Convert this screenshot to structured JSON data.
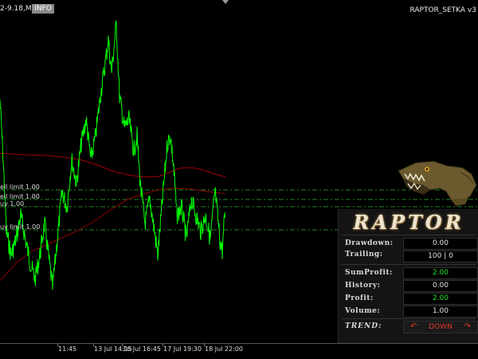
{
  "header": {
    "symbol_timeframe": "2-9.18,M15",
    "info_button": "INFO",
    "indicator_title": "RAPTOR_SETKA v3"
  },
  "chart": {
    "order_labels": [
      {
        "label": "ell limit 1.00"
      },
      {
        "label": "ell limit 1.00"
      },
      {
        "label": "uy 1.00"
      },
      {
        "label": "uy limit 1.00"
      }
    ],
    "time_ticks": [
      "11:45",
      "13 Jul 14:15",
      "16 Jul 16:45",
      "17 Jul 19:30",
      "18 Jul 22:00"
    ],
    "colors": {
      "price_line": "#00ff00",
      "moving_average": "#b80000",
      "level_lines": "#00c800"
    }
  },
  "panel": {
    "brand": "RAPTOR",
    "rows": [
      {
        "label": "Drawdown:",
        "value": "0.00",
        "color": "#e6e6e6"
      },
      {
        "label": "Trailing:",
        "value": "100  |  0",
        "color": "#e6e6e6"
      },
      {
        "label": "SumProfit:",
        "value": "2.00",
        "color": "#22e02a"
      },
      {
        "label": "History:",
        "value": "0.00",
        "color": "#e6e6e6"
      },
      {
        "label": "Profit:",
        "value": "2.00",
        "color": "#22e02a"
      },
      {
        "label": "Volume:",
        "value": "1.00",
        "color": "#e6e6e6"
      }
    ],
    "trend": {
      "label": "TREND:",
      "value": "DOWN",
      "color": "#e03a2a"
    }
  }
}
